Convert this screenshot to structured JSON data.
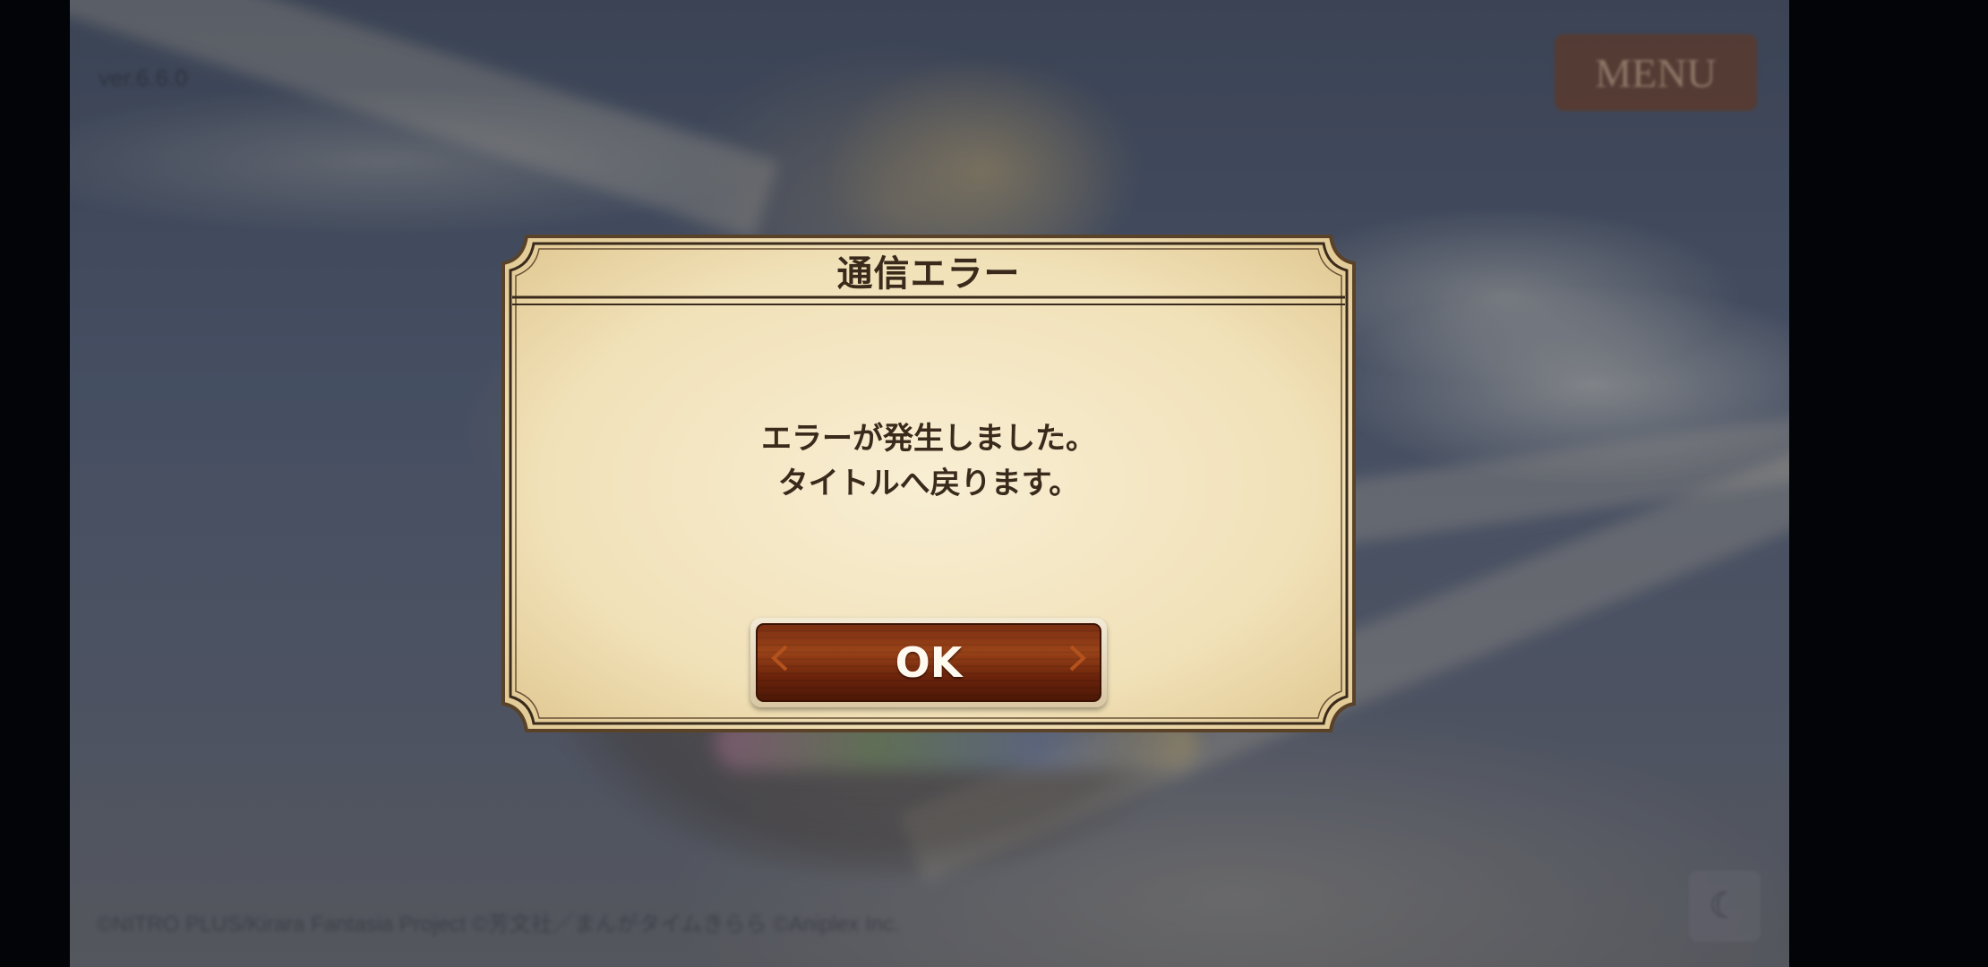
{
  "background": {
    "version_text": "ver.6.6.0",
    "menu_label": "MENU",
    "copyright_text": "©NITRO PLUS/Kirara Fantasia Project ©芳文社／まんがタイムきらら ©Aniplex Inc.",
    "corner_icon": "moon-icon"
  },
  "dialog": {
    "title": "通信エラー",
    "message_line1": "エラーが発生しました。",
    "message_line2": "タイトルへ戻ります。",
    "ok_label": "OK"
  },
  "colors": {
    "dialog_paper": "#f4e6c2",
    "dialog_border": "#3a2a1c",
    "button_brown": "#7a2f12",
    "overlay": "rgba(10,14,28,0.35)"
  }
}
